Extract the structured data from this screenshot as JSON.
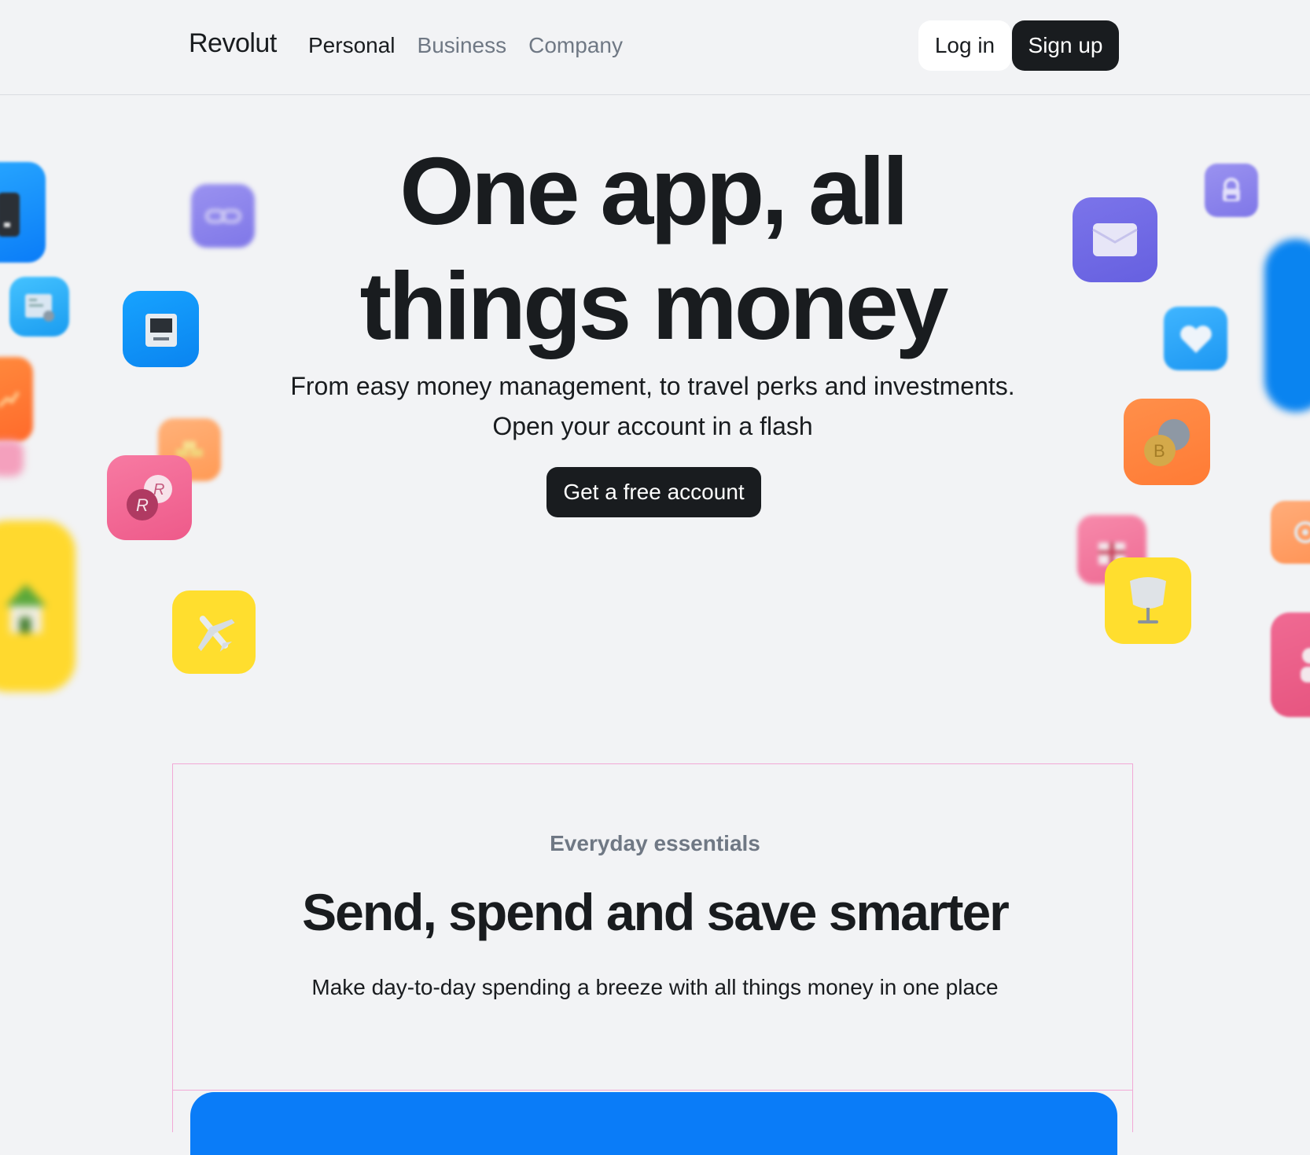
{
  "header": {
    "logo": "Revolut",
    "nav": [
      "Personal",
      "Business",
      "Company"
    ],
    "login": "Log in",
    "signup": "Sign up"
  },
  "hero": {
    "title_line1": "One app, all",
    "title_line2": "things money",
    "subtitle_line1": "From easy money management, to travel perks and investments.",
    "subtitle_line2": "Open your account in a flash",
    "cta": "Get a free account"
  },
  "section": {
    "eyebrow": "Everyday essentials",
    "title": "Send, spend and save smarter",
    "subtitle": "Make day-to-day spending a breeze with all things money in one place"
  },
  "icons": [
    "wallet-icon",
    "link-icon",
    "atm-icon",
    "document-icon",
    "chart-icon",
    "gold-bars-icon",
    "revolut-points-icon",
    "house-icon",
    "airplane-icon",
    "lock-icon",
    "envelope-icon",
    "heart-icon",
    "crypto-coins-icon",
    "gift-icon",
    "chair-icon",
    "vault-icon",
    "person-icon",
    "phone-icon"
  ],
  "colors": {
    "background": "#f2f3f5",
    "primary_dark": "#191c1f",
    "muted_text": "#6f7884",
    "accent_blue": "#0a7cf8",
    "section_border": "#f2a8d6"
  }
}
